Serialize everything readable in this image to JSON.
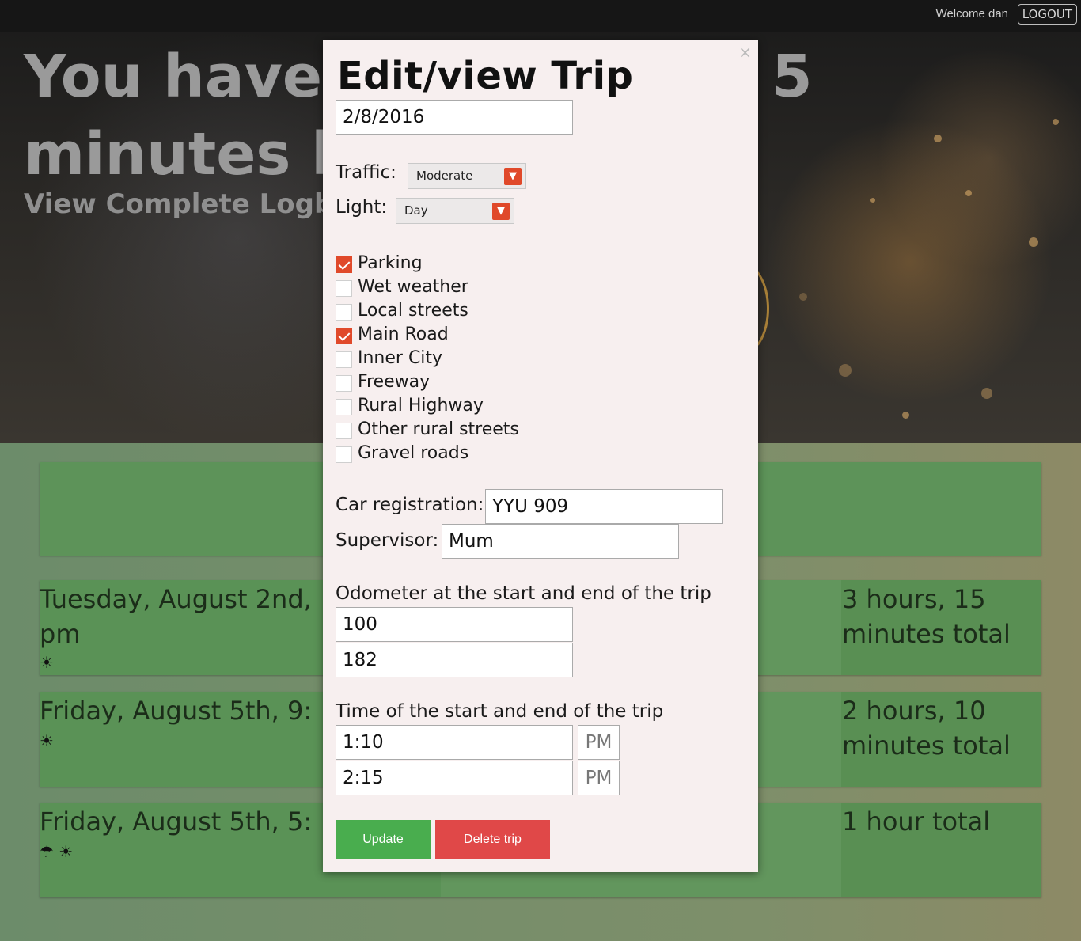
{
  "header": {
    "welcome_text": "Welcome dan",
    "logout_label": "LOGOUT"
  },
  "hero": {
    "title_line1": "You have",
    "title_line1_suffix": "5",
    "title_line2": "minutes l",
    "subtitle": "View Complete Logb"
  },
  "trips": [
    {
      "date": "Tuesday, August 2nd,",
      "date_cont": "pm",
      "icons": "☀",
      "total": "3 hours, 15 minutes total"
    },
    {
      "date": "Friday, August 5th, 9:",
      "date_cont": "",
      "icons": "☀",
      "total": "2 hours, 10 minutes total"
    },
    {
      "date": "Friday, August 5th, 5:",
      "date_cont": "",
      "icons": "☂ ☀",
      "total": "1 hour total"
    }
  ],
  "modal": {
    "close_glyph": "×",
    "title": "Edit/view Trip",
    "date_value": "2/8/2016",
    "traffic": {
      "label": "Traffic:",
      "value": "Moderate"
    },
    "light": {
      "label": "Light:",
      "value": "Day"
    },
    "conditions": [
      {
        "label": "Parking",
        "checked": true
      },
      {
        "label": "Wet weather",
        "checked": false
      },
      {
        "label": "Local streets",
        "checked": false
      },
      {
        "label": "Main Road",
        "checked": true
      },
      {
        "label": "Inner City",
        "checked": false
      },
      {
        "label": "Freeway",
        "checked": false
      },
      {
        "label": "Rural Highway",
        "checked": false
      },
      {
        "label": "Other rural streets",
        "checked": false
      },
      {
        "label": "Gravel roads",
        "checked": false
      }
    ],
    "car_registration": {
      "label": "Car registration:",
      "value": "YYU 909"
    },
    "supervisor": {
      "label": "Supervisor:",
      "value": "Mum"
    },
    "odometer": {
      "label": "Odometer at the start and end of the trip",
      "start": "100",
      "end": "182"
    },
    "time": {
      "label": "Time of the start and end of the trip",
      "start": "1:10",
      "start_ampm": "PM",
      "end": "2:15",
      "end_ampm": "PM"
    },
    "update_label": "Update",
    "delete_label": "Delete trip"
  },
  "colors": {
    "accent": "#e0492a",
    "update_button": "#49ad4e",
    "delete_button": "#e04848",
    "modal_bg": "#f7efef",
    "trip_green": "#5c9457"
  }
}
